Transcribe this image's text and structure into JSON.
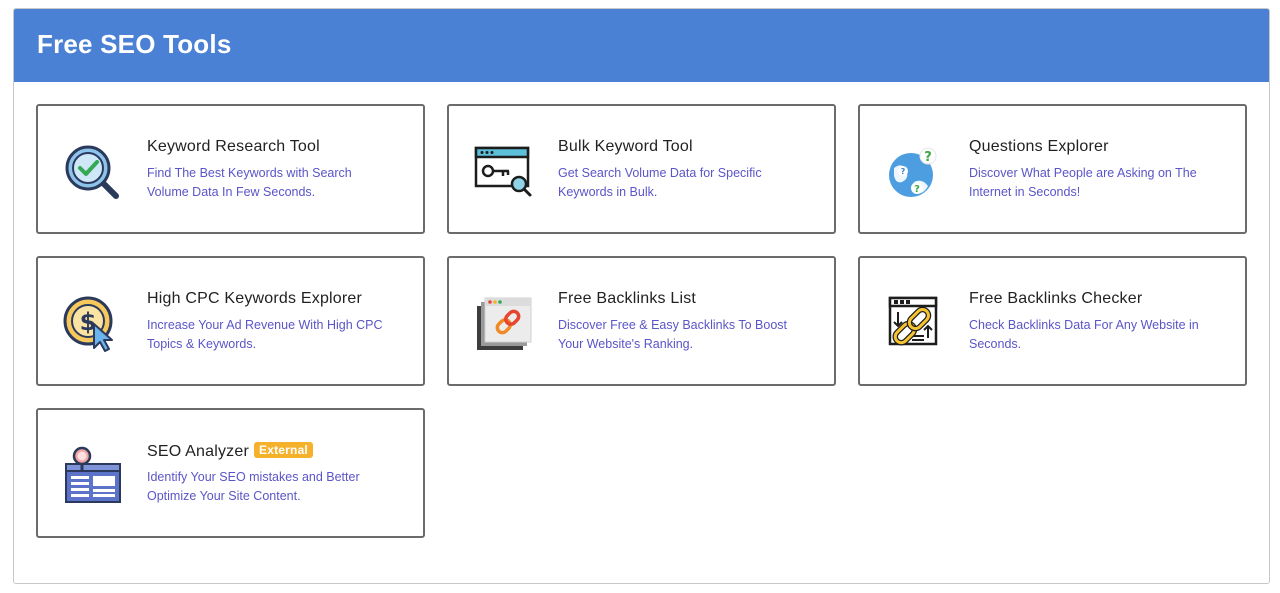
{
  "header": {
    "title": "Free SEO Tools"
  },
  "tools": [
    {
      "title": "Keyword Research Tool",
      "description": "Find The Best Keywords with Search Volume Data In Few Seconds.",
      "icon": "magnifier-check-icon"
    },
    {
      "title": "Bulk Keyword Tool",
      "description": "Get Search Volume Data for Specific Keywords in Bulk.",
      "icon": "browser-key-icon"
    },
    {
      "title": "Questions Explorer",
      "description": "Discover What People are Asking on The Internet in Seconds!",
      "icon": "globe-question-icon"
    },
    {
      "title": "High CPC Keywords Explorer",
      "description": "Increase Your Ad Revenue With High CPC Topics & Keywords.",
      "icon": "dollar-cursor-icon"
    },
    {
      "title": "Free Backlinks List",
      "description": "Discover Free & Easy Backlinks To Boost Your Website's Ranking.",
      "icon": "link-window-icon"
    },
    {
      "title": "Free Backlinks Checker",
      "description": "Check Backlinks Data For Any Website in Seconds.",
      "icon": "chain-document-icon"
    },
    {
      "title": "SEO Analyzer",
      "badge": "External",
      "description": "Identify Your SEO mistakes and Better Optimize Your Site Content.",
      "icon": "analyzer-page-icon"
    }
  ],
  "colors": {
    "header": "#4a81d4",
    "description": "#5a55c8",
    "badge": "#f5b12a"
  }
}
